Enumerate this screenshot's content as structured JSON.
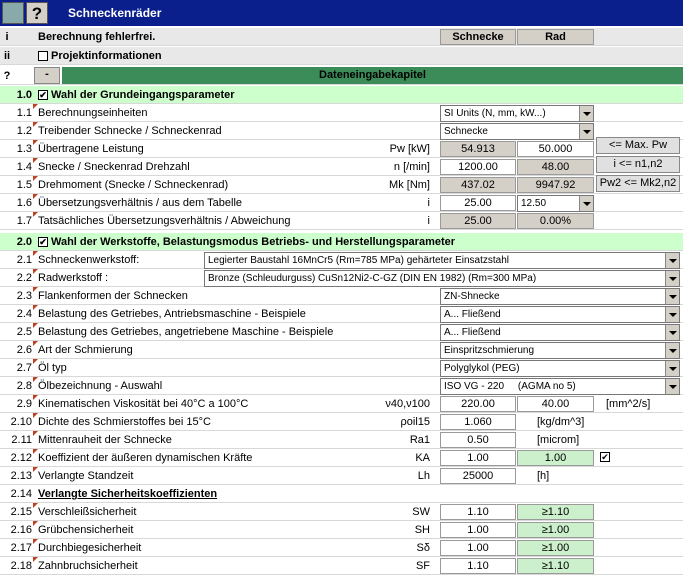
{
  "title": "Schneckenräder",
  "header": {
    "i": "i",
    "status": "Berechnung fehlerfrei.",
    "col1": "Schnecke",
    "col2": "Rad"
  },
  "ii": {
    "num": "ii",
    "label": "Projektinformationen"
  },
  "chapter": {
    "q": "?",
    "minus": "-",
    "label": "Dateneingabekapitel"
  },
  "sec1": {
    "num": "1.0",
    "label": "Wahl der Grundeingangsparameter"
  },
  "r1_1": {
    "num": "1.1",
    "label": "Berechnungseinheiten",
    "value": "SI Units (N, mm, kW...)"
  },
  "r1_2": {
    "num": "1.2",
    "label": "Treibender Schnecke / Schneckenrad",
    "value": "Schnecke"
  },
  "r1_3": {
    "num": "1.3",
    "label": "Übertragene Leistung",
    "sym": "Pw [kW]",
    "v1": "54.913",
    "v2": "50.000",
    "btn": "<= Max. Pw"
  },
  "r1_4": {
    "num": "1.4",
    "label": "Snecke / Sneckenrad Drehzahl",
    "sym": "n [/min]",
    "v1": "1200.00",
    "v2": "48.00",
    "btn": "i <= n1,n2"
  },
  "r1_5": {
    "num": "1.5",
    "label": "Drehmoment (Snecke / Schneckenrad)",
    "sym": "Mk [Nm]",
    "v1": "437.02",
    "v2": "9947.92",
    "btn": "Pw2 <= Mk2,n2"
  },
  "r1_6": {
    "num": "1.6",
    "label": "Übersetzungsverhältnis / aus dem Tabelle",
    "sym": "i",
    "v1": "25.00",
    "v2": "12.50"
  },
  "r1_7": {
    "num": "1.7",
    "label": "Tatsächliches Übersetzungsverhältnis / Abweichung",
    "sym": "i",
    "v1": "25.00",
    "v2": "0.00%"
  },
  "sec2": {
    "num": "2.0",
    "label": "Wahl der Werkstoffe, Belastungsmodus Betriebs- und Herstellungsparameter"
  },
  "r2_1": {
    "num": "2.1",
    "label": "Schneckenwerkstoff:",
    "value": "Legierter Baustahl 16MnCr5 (Rm=785 MPa) gehärteter Einsatzstahl"
  },
  "r2_2": {
    "num": "2.2",
    "label": "Radwerkstoff :",
    "value": "Bronze (Schleudurguss) CuSn12Ni2-C-GZ (DIN EN 1982) (Rm=300 MPa)"
  },
  "r2_3": {
    "num": "2.3",
    "label": "Flankenformen der Schnecken",
    "value": "ZN-Shnecke"
  },
  "r2_4": {
    "num": "2.4",
    "label": "Belastung des Getriebes, Antriebsmaschine - Beispiele",
    "value": "A... Fließend"
  },
  "r2_5": {
    "num": "2.5",
    "label": "Belastung des Getriebes, angetriebene Maschine - Beispiele",
    "value": "A... Fließend"
  },
  "r2_6": {
    "num": "2.6",
    "label": "Art der Schmierung",
    "value": "Einspritzschmierung"
  },
  "r2_7": {
    "num": "2.7",
    "label": "Öl typ",
    "value": "Polyglykol (PEG)"
  },
  "r2_8": {
    "num": "2.8",
    "label": "Ölbezeichnung - Auswahl",
    "value": "ISO VG - 220     (AGMA no 5)"
  },
  "r2_9": {
    "num": "2.9",
    "label": "Kinematischen Viskosität bei 40°C a 100°C",
    "sym": "ν40,ν100",
    "v1": "220.00",
    "v2": "40.00",
    "unit": "[mm^2/s]"
  },
  "r2_10": {
    "num": "2.10",
    "label": "Dichte des Schmierstoffes bei 15°C",
    "sym": "ρoil15",
    "v1": "1.060",
    "unit": "[kg/dm^3]"
  },
  "r2_11": {
    "num": "2.11",
    "label": "Mittenrauheit der Schnecke",
    "sym": "Ra1",
    "v1": "0.50",
    "unit": "[microm]"
  },
  "r2_12": {
    "num": "2.12",
    "label": "Koeffizient der äußeren dynamischen Kräfte",
    "sym": "KA",
    "v1": "1.00",
    "v2": "1.00"
  },
  "r2_13": {
    "num": "2.13",
    "label": "Verlangte Standzeit",
    "sym": "Lh",
    "v1": "25000",
    "unit": "[h]"
  },
  "r2_14": {
    "num": "2.14",
    "label": "Verlangte Sicherheitskoeffizienten"
  },
  "r2_15": {
    "num": "2.15",
    "label": "Verschleißsicherheit",
    "sym": "SW",
    "v1": "1.10",
    "v2": "≥1.10"
  },
  "r2_16": {
    "num": "2.16",
    "label": "Grübchensicherheit",
    "sym": "SH",
    "v1": "1.00",
    "v2": "≥1.00"
  },
  "r2_17": {
    "num": "2.17",
    "label": "Durchbiegesicherheit",
    "sym": "Sδ",
    "v1": "1.00",
    "v2": "≥1.00"
  },
  "r2_18": {
    "num": "2.18",
    "label": "Zahnbruchsicherheit",
    "sym": "SF",
    "v1": "1.10",
    "v2": "≥1.10"
  }
}
